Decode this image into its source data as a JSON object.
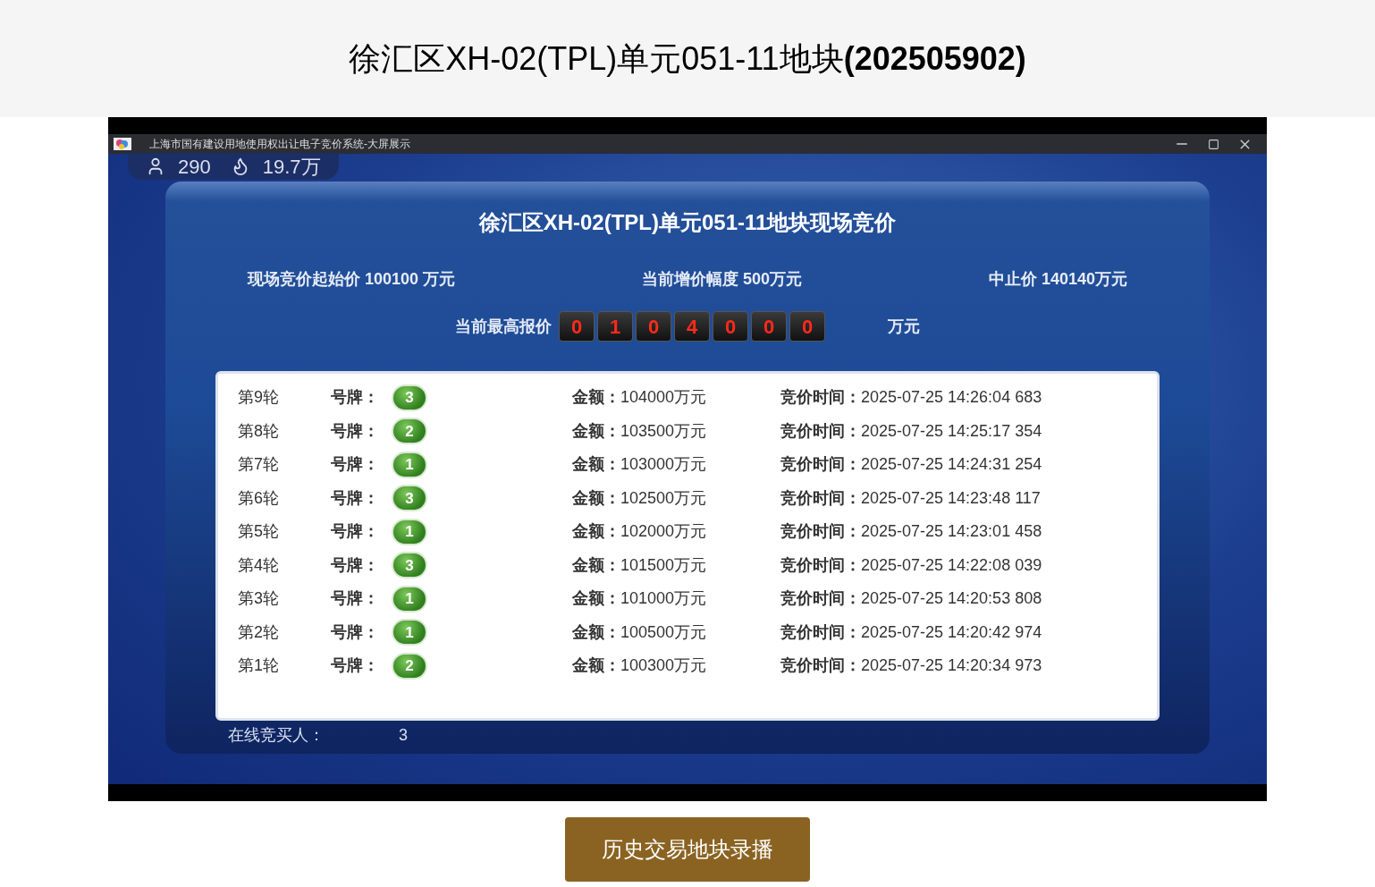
{
  "page_title": "徐汇区XH-02(TPL)单元051-11地块**(202505902)**",
  "video": {
    "window_title": "上海市国有建设用地使用权出让电子竞价系统-大屏展示",
    "viewers": "290",
    "popularity": "19.7万",
    "heading": "徐汇区XH-02(TPL)单元051-11地块现场竞价",
    "info": [
      "现场竞价起始价 100100 万元",
      "当前增价幅度 500万元",
      "中止价 140140万元"
    ],
    "highest_bid_label": "当前最高报价",
    "highest_bid_digits": [
      "0",
      "1",
      "0",
      "4",
      "0",
      "0",
      "0"
    ],
    "highest_bid_unit": "万元",
    "bids": [
      {
        "round": "第9轮",
        "plate_label": "号牌：",
        "plate": "3",
        "amount_label": "金额：",
        "amount": "104000万元",
        "time_label": "竞价时间：",
        "time": "2025-07-25 14:26:04 683"
      },
      {
        "round": "第8轮",
        "plate_label": "号牌：",
        "plate": "2",
        "amount_label": "金额：",
        "amount": "103500万元",
        "time_label": "竞价时间：",
        "time": "2025-07-25 14:25:17 354"
      },
      {
        "round": "第7轮",
        "plate_label": "号牌：",
        "plate": "1",
        "amount_label": "金额：",
        "amount": "103000万元",
        "time_label": "竞价时间：",
        "time": "2025-07-25 14:24:31 254"
      },
      {
        "round": "第6轮",
        "plate_label": "号牌：",
        "plate": "3",
        "amount_label": "金额：",
        "amount": "102500万元",
        "time_label": "竞价时间：",
        "time": "2025-07-25 14:23:48 117"
      },
      {
        "round": "第5轮",
        "plate_label": "号牌：",
        "plate": "1",
        "amount_label": "金额：",
        "amount": "102000万元",
        "time_label": "竞价时间：",
        "time": "2025-07-25 14:23:01 458"
      },
      {
        "round": "第4轮",
        "plate_label": "号牌：",
        "plate": "3",
        "amount_label": "金额：",
        "amount": "101500万元",
        "time_label": "竞价时间：",
        "time": "2025-07-25 14:22:08 039"
      },
      {
        "round": "第3轮",
        "plate_label": "号牌：",
        "plate": "1",
        "amount_label": "金额：",
        "amount": "101000万元",
        "time_label": "竞价时间：",
        "time": "2025-07-25 14:20:53 808"
      },
      {
        "round": "第2轮",
        "plate_label": "号牌：",
        "plate": "1",
        "amount_label": "金额：",
        "amount": "100500万元",
        "time_label": "竞价时间：",
        "time": "2025-07-25 14:20:42 974"
      },
      {
        "round": "第1轮",
        "plate_label": "号牌：",
        "plate": "2",
        "amount_label": "金额：",
        "amount": "100300万元",
        "time_label": "竞价时间：",
        "time": "2025-07-25 14:20:34 973"
      }
    ],
    "online_label": "在线竞买人：",
    "online_count": "3"
  },
  "history_button": "历史交易地块录播"
}
